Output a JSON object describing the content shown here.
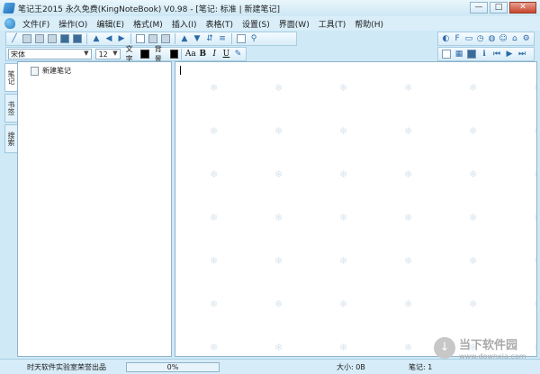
{
  "window": {
    "title": "笔记王2015 永久免费(KingNoteBook) V0.98 - [笔记: 标准 | 新建笔记]",
    "minimize": "—",
    "maximize": "□",
    "close": "✕"
  },
  "menu": [
    "文件(F)",
    "操作(O)",
    "编辑(E)",
    "格式(M)",
    "插入(I)",
    "表格(T)",
    "设置(S)",
    "界面(W)",
    "工具(T)",
    "帮助(H)"
  ],
  "format_bar": {
    "font": "宋体",
    "size": "12",
    "text_color_label": "文字",
    "bg_color_label": "背景",
    "text_color": "#000000",
    "bg_color": "#000000",
    "font_size_btn": "Aa",
    "bold": "B",
    "italic": "I",
    "underline": "U"
  },
  "side_tabs": [
    "笔记",
    "书签",
    "搜索"
  ],
  "tree": {
    "root_label": "新建笔记"
  },
  "status": {
    "credit": "时天软件实验室荣誉出品",
    "progress": "0%",
    "progress_value": 0,
    "size": "大小: 0B",
    "notes": "笔记: 1"
  },
  "watermark": {
    "title": "当下软件园",
    "url": "www.downxia.com"
  },
  "colors": {
    "accent": "#2a7fc5",
    "background": "#cfe9f6",
    "border": "#8fb3cc"
  }
}
